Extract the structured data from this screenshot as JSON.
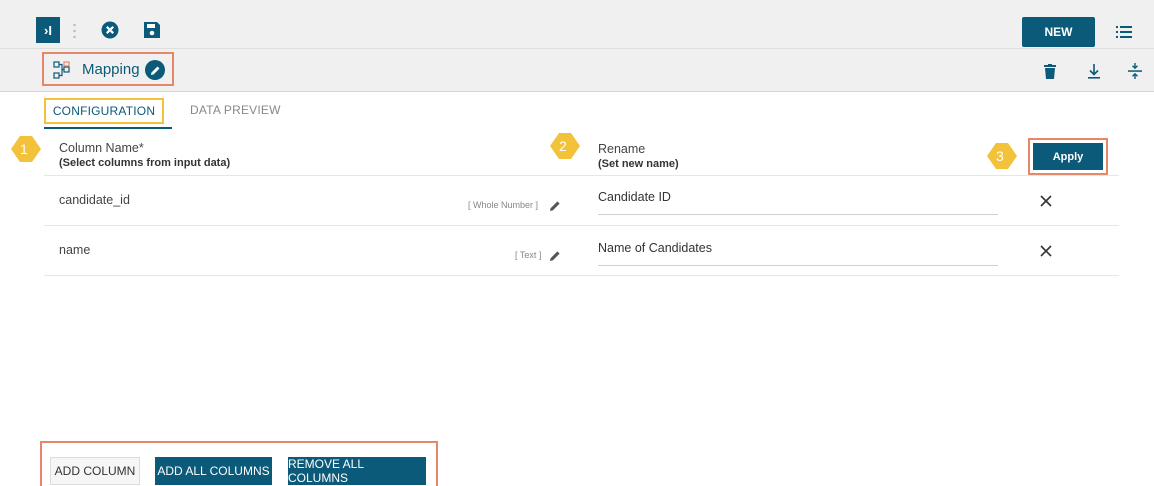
{
  "toolbar": {
    "expand_label": "›I",
    "new_label": "NEW",
    "icons": [
      "expand-icon",
      "close-circle-icon",
      "save-icon",
      "list-icon"
    ]
  },
  "title": {
    "text": "Mapping",
    "icons": [
      "mapping-icon",
      "edit-icon",
      "delete-icon",
      "download-icon",
      "split-icon"
    ]
  },
  "tabs": [
    {
      "label": "CONFIGURATION",
      "active": true
    },
    {
      "label": "DATA PREVIEW",
      "active": false
    }
  ],
  "headers": {
    "column": {
      "marker": "1",
      "label": "Column Name*",
      "sub": "(Select columns from input data)"
    },
    "rename": {
      "marker": "2",
      "label": "Rename",
      "sub": "(Set new name)"
    },
    "apply": {
      "marker": "3",
      "label": "Apply"
    }
  },
  "rows": [
    {
      "column": "candidate_id",
      "type": "[ Whole Number ]",
      "rename": "Candidate ID"
    },
    {
      "column": "name",
      "type": "[ Text ]",
      "rename": "Name of Candidates"
    }
  ],
  "footer": {
    "add_column": "ADD COLUMN",
    "add_all": "ADD ALL COLUMNS",
    "remove_all": "REMOVE ALL COLUMNS"
  },
  "colors": {
    "primary": "#0b5a79",
    "highlight_orange": "#e8866a",
    "highlight_yellow": "#f3c23b"
  }
}
